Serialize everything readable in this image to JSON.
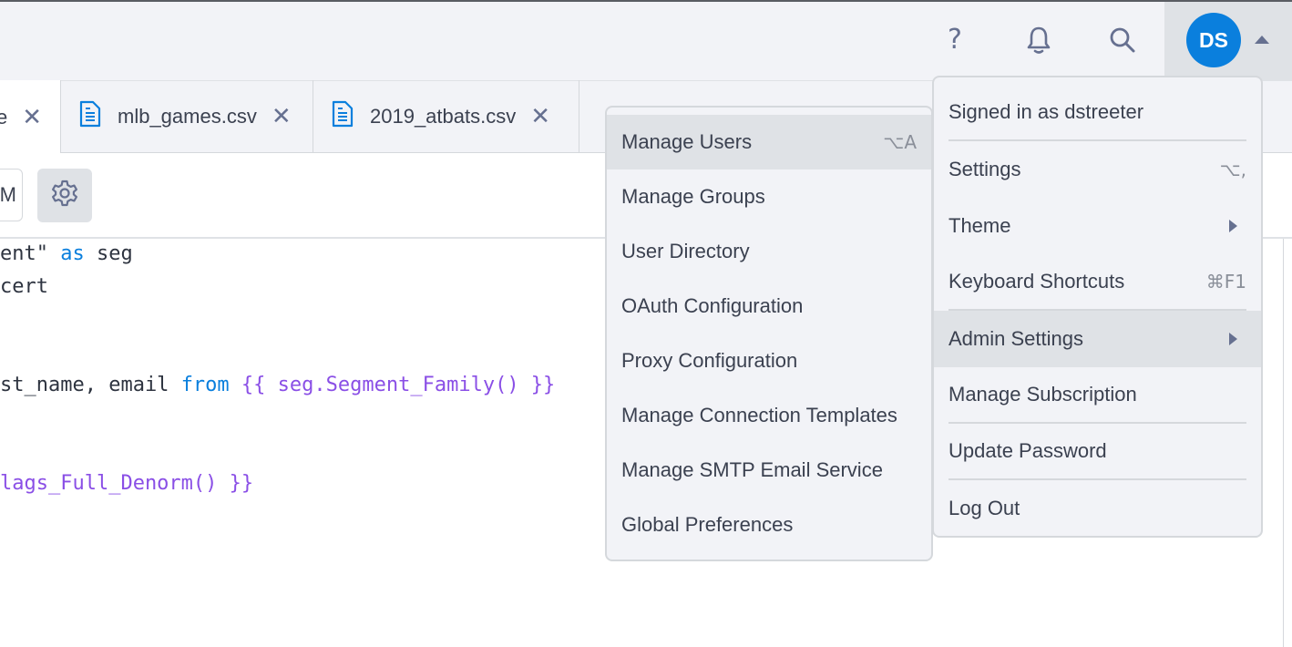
{
  "header": {
    "icons": [
      "help-icon",
      "bell-icon",
      "search-icon"
    ],
    "help_glyph": "?",
    "avatar_initials": "DS",
    "avatar_color": "#0a7fdd"
  },
  "tabs": [
    {
      "name": "e",
      "icon": "file-icon",
      "active": true
    },
    {
      "name": "mlb_games.csv",
      "icon": "file-icon",
      "active": false
    },
    {
      "name": "2019_atbats.csv",
      "icon": "file-icon",
      "active": false
    }
  ],
  "tab_close_glyph": "✕",
  "toolbar": {
    "connection_partial": "M"
  },
  "editor": {
    "lines": [
      [
        {
          "t": "ent\" ",
          "c": ""
        },
        {
          "t": "as",
          "c": "kw"
        },
        {
          "t": " seg",
          "c": ""
        }
      ],
      [
        {
          "t": "cert",
          "c": ""
        }
      ],
      [
        {
          "t": "st_name, email ",
          "c": ""
        },
        {
          "t": "from",
          "c": "kw"
        },
        {
          "t": " {{ seg.",
          "c": "tpl"
        },
        {
          "t": "Segment_Family() }}",
          "c": "tpl"
        }
      ],
      [
        {
          "t": "lags_Full_Denorm() }}",
          "c": "tpl"
        }
      ]
    ],
    "colors": {
      "keyword": "#0a7fdd",
      "template": "#8a4fe6"
    }
  },
  "admin_submenu": {
    "items": [
      {
        "label": "Manage Users",
        "shortcut": "⌥A",
        "highlighted": true
      },
      {
        "label": "Manage Groups"
      },
      {
        "label": "User Directory"
      },
      {
        "label": "OAuth Configuration"
      },
      {
        "label": "Proxy Configuration"
      },
      {
        "label": "Manage Connection Templates"
      },
      {
        "label": "Manage SMTP Email Service"
      },
      {
        "label": "Global Preferences"
      }
    ]
  },
  "user_menu": {
    "signed_in": "Signed in as dstreeter",
    "items": [
      {
        "label": "Settings",
        "shortcut": "⌥,"
      },
      {
        "label": "Theme",
        "submenu": true
      },
      {
        "label": "Keyboard Shortcuts",
        "shortcut": "⌘F1"
      },
      {
        "label": "Admin Settings",
        "submenu": true,
        "highlighted": true
      },
      {
        "label": "Manage Subscription"
      },
      {
        "label": "Update Password"
      },
      {
        "label": "Log Out"
      }
    ]
  }
}
